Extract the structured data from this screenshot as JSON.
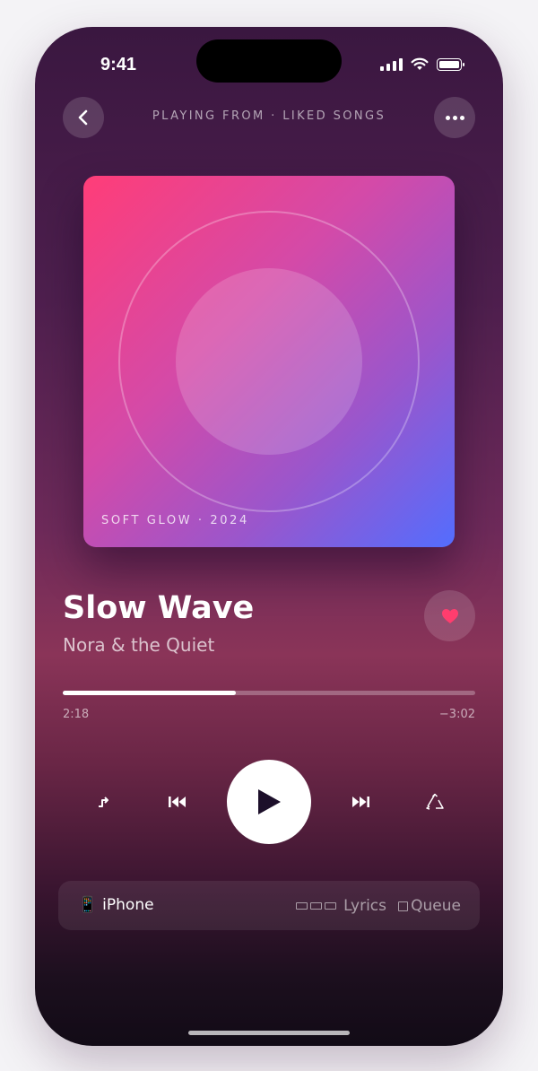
{
  "status_bar": {
    "time": "9:41"
  },
  "header": {
    "playing_from": "PLAYING FROM · LIKED SONGS"
  },
  "artwork": {
    "caption": "SOFT GLOW · 2024"
  },
  "track": {
    "title": "Slow Wave",
    "artist": "Nora & the Quiet",
    "liked": true
  },
  "progress": {
    "elapsed": "2:18",
    "remaining": "−3:02",
    "fraction": 0.42
  },
  "bottom_bar": {
    "device_label": "iPhone",
    "lyrics_label": "Lyrics",
    "queue_label": "Queue"
  },
  "icons": {
    "back": "chevron-left-icon",
    "more": "ellipsis-icon",
    "heart": "heart-icon",
    "shuffle": "shuffle-icon",
    "prev": "skip-back-icon",
    "play": "play-icon",
    "next": "skip-forward-icon",
    "repeat": "repeat-icon",
    "device": "phone-icon",
    "lyrics": "lyrics-icon",
    "queue": "queue-icon"
  },
  "colors": {
    "artwork_gradient": [
      "#ff3d78",
      "#d44aa8",
      "#9a56cc",
      "#536dfe"
    ],
    "heart": "#ff3d6e",
    "background_top": "#3a1740",
    "background_bottom": "#120b16"
  }
}
